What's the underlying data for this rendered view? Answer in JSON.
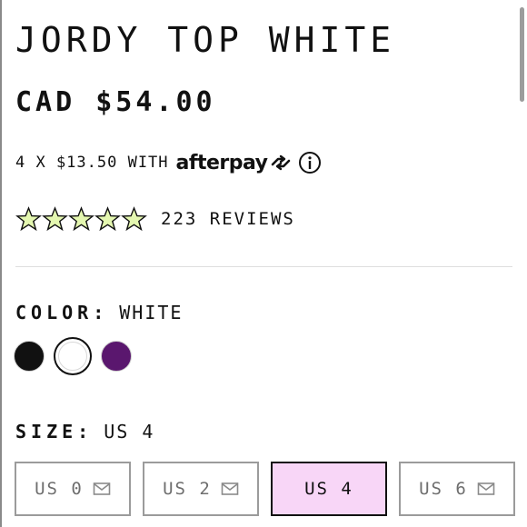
{
  "product": {
    "title": "JORDY TOP WHITE",
    "price": "CAD $54.00"
  },
  "installments": {
    "text": "4 X $13.50 WITH",
    "provider_logo_text": "afterpay",
    "provider_icon": "afterpay-arrows-icon",
    "info_icon": "info-icon"
  },
  "reviews": {
    "rating": 5,
    "max_rating": 5,
    "label": "223 REVIEWS",
    "star_color": "#e4f7b0"
  },
  "color": {
    "label": "COLOR:",
    "selected": "WHITE",
    "swatches": [
      {
        "name": "black",
        "hex": "#111111",
        "selected": false
      },
      {
        "name": "white",
        "hex": "#ffffff",
        "selected": true
      },
      {
        "name": "purple",
        "hex": "#5a176e",
        "selected": false
      }
    ]
  },
  "size": {
    "label": "SIZE:",
    "selected": "US 4",
    "options": [
      {
        "label": "US 0",
        "available": false,
        "icon": "mail-icon"
      },
      {
        "label": "US 2",
        "available": false,
        "icon": "mail-icon"
      },
      {
        "label": "US 4",
        "available": true,
        "selected": true
      },
      {
        "label": "US 6",
        "available": false,
        "icon": "mail-icon"
      }
    ]
  },
  "colors": {
    "selected_size_bg": "#f8d6f7",
    "text": "#111111",
    "muted": "#6e6e6e"
  }
}
